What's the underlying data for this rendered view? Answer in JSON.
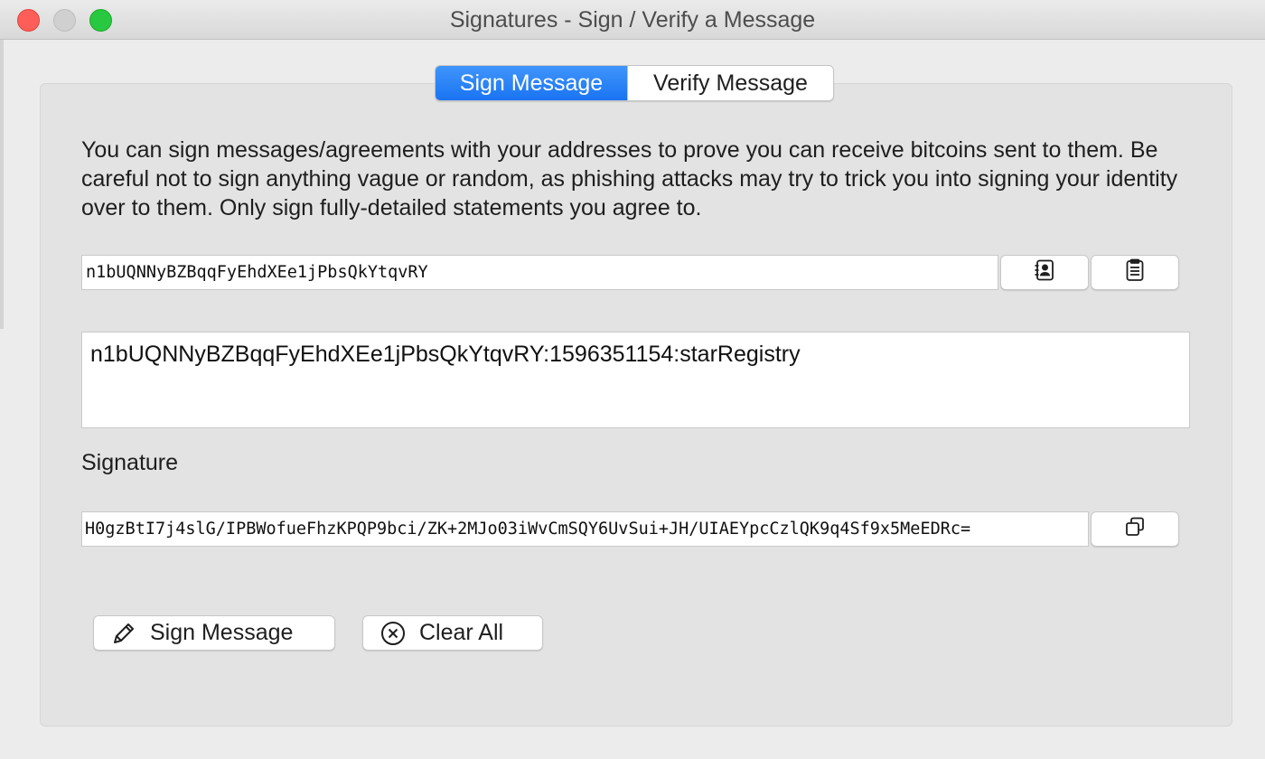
{
  "window": {
    "title": "Signatures - Sign / Verify a Message"
  },
  "tabs": [
    {
      "label": "Sign Message",
      "active": true
    },
    {
      "label": "Verify Message",
      "active": false
    }
  ],
  "sign": {
    "description": "You can sign messages/agreements with your addresses to prove you can receive bitcoins sent to them. Be careful not to sign anything vague or random, as phishing attacks may try to trick you into signing your identity over to them. Only sign fully-detailed statements you agree to.",
    "address_value": "n1bUQNNyBZBqqFyEhdXEe1jPbsQkYtqvRY",
    "address_book_icon": "address-book-icon",
    "paste_icon": "clipboard-paste-icon",
    "message_value": "n1bUQNNyBZBqqFyEhdXEe1jPbsQkYtqvRY:1596351154:starRegistry",
    "signature_label": "Signature",
    "signature_value": "H0gzBtI7j4slG/IPBWofueFhzKPQP9bci/ZK+2MJo03iWvCmSQY6UvSui+JH/UIAEYpcCzlQK9q4Sf9x5MeEDRc=",
    "copy_icon": "copy-icon",
    "sign_button_label": "Sign Message",
    "sign_button_icon": "pencil-icon",
    "clear_button_label": "Clear All",
    "clear_button_icon": "circle-x-icon"
  },
  "colors": {
    "accent": "#1a74f2",
    "close": "#fd5e57",
    "minimize_inactive": "#d0d0d0",
    "maximize": "#28c840"
  }
}
